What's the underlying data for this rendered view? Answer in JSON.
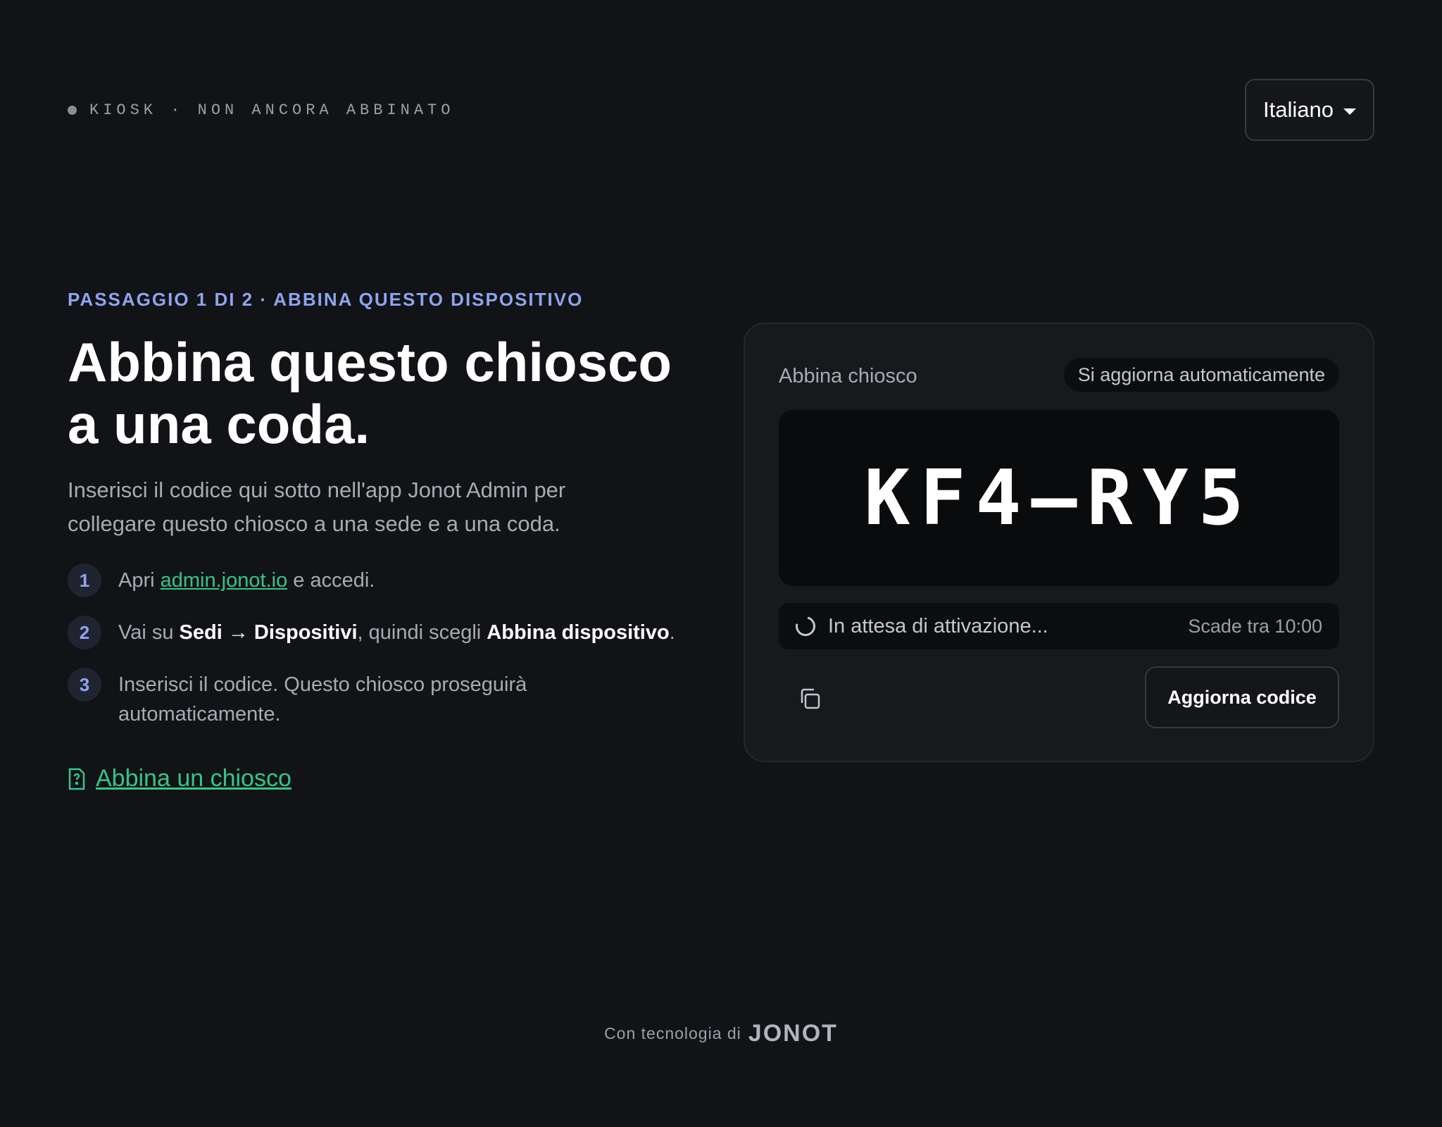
{
  "header": {
    "status_text": "KIOSK · NON ANCORA ABBINATO",
    "language": "Italiano"
  },
  "intro": {
    "step_label": "PASSAGGIO 1 DI 2 · ABBINA QUESTO DISPOSITIVO",
    "title": "Abbina questo chiosco a una coda.",
    "lead": "Inserisci il codice qui sotto nell'app Jonot Admin per collegare questo chiosco a una sede e a una coda."
  },
  "steps": [
    {
      "number": "1",
      "prefix": "Apri ",
      "link": "admin.jonot.io",
      "suffix": " e accedi."
    },
    {
      "number": "2",
      "prefix": "Vai su ",
      "bold1": "Sedi → Dispositivi",
      "middle": ", quindi scegli ",
      "bold2": "Abbina dispositivo",
      "suffix": "."
    },
    {
      "number": "3",
      "text": "Inserisci il codice. Questo chiosco proseguirà automaticamente."
    }
  ],
  "help_link": "Abbina un chiosco",
  "card": {
    "title": "Abbina chiosco",
    "auto_badge": "Si aggiorna automaticamente",
    "code": "KF4–RY5",
    "waiting_text": "In attesa di attivazione...",
    "expires_text": "Scade tra 10:00",
    "refresh_label": "Aggiorna codice"
  },
  "footer": {
    "powered_by": "Con tecnologia di",
    "brand": "JONOT"
  },
  "colors": {
    "background": "#111316",
    "accent_blue": "#8ea4ee",
    "accent_green": "#34c58a",
    "card": "#18191d"
  },
  "icons": {
    "copy": "copy-icon",
    "help": "help-doc-icon",
    "spinner": "spinner-icon",
    "dropdown": "chevron-down-icon"
  }
}
